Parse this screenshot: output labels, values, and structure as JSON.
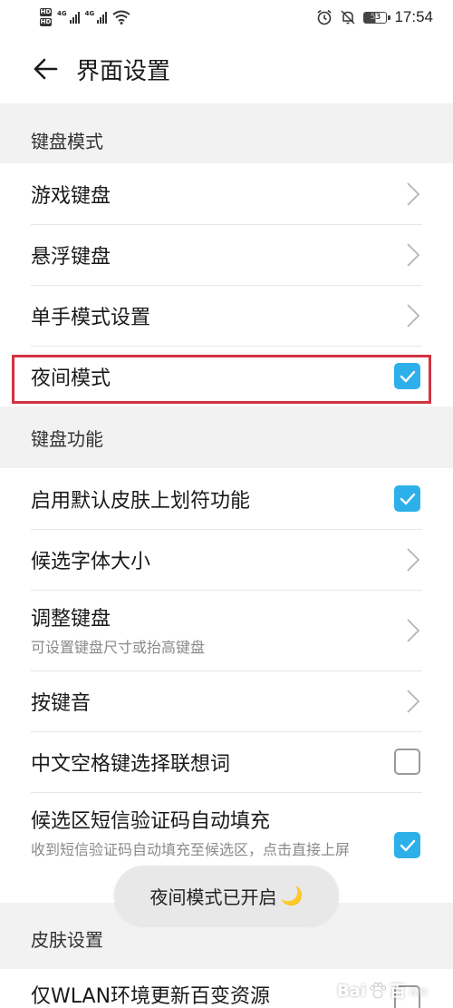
{
  "status_bar": {
    "hd1": "HD",
    "hd2": "HD",
    "net1": "4G",
    "net2": "4G",
    "battery": "53",
    "time": "17:54"
  },
  "header": {
    "title": "界面设置"
  },
  "sections": {
    "keyboard_mode": "键盘模式",
    "keyboard_function": "键盘功能",
    "skin_settings": "皮肤设置"
  },
  "keyboard_mode_items": [
    {
      "title": "游戏键盘",
      "control": "chevron"
    },
    {
      "title": "悬浮键盘",
      "control": "chevron"
    },
    {
      "title": "单手模式设置",
      "control": "chevron"
    },
    {
      "title": "夜间模式",
      "control": "checkbox",
      "checked": true
    }
  ],
  "keyboard_function_items": [
    {
      "title": "启用默认皮肤上划符功能",
      "control": "checkbox",
      "checked": true
    },
    {
      "title": "候选字体大小",
      "control": "chevron"
    },
    {
      "title": "调整键盘",
      "subtitle": "可设置键盘尺寸或抬高键盘",
      "control": "chevron"
    },
    {
      "title": "按键音",
      "control": "chevron"
    },
    {
      "title": "中文空格键选择联想词",
      "control": "checkbox",
      "checked": false
    },
    {
      "title": "候选区短信验证码自动填充",
      "subtitle": "收到短信验证码自动填充至候选区，点击直接上屏",
      "control": "checkbox",
      "checked": true
    }
  ],
  "skin_items": [
    {
      "title": "仅WLAN环境更新百变资源"
    }
  ],
  "toast": {
    "text": "夜间模式已开启",
    "emoji": "🌙"
  },
  "watermark": {
    "text": "Bai",
    "text2": "百",
    "suffix": "经验"
  },
  "colors": {
    "accent": "#2db0ea",
    "highlight": "#d23440",
    "background": "#f2f2f2"
  }
}
